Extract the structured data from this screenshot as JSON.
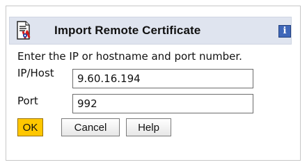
{
  "dialog": {
    "title": "Import Remote Certificate",
    "instruction": "Enter the IP or hostname and port number.",
    "icons": {
      "dialog": "certificate-icon",
      "info": "info-icon"
    }
  },
  "fields": {
    "ip_host": {
      "label": "IP/Host",
      "value": "9.60.16.194"
    },
    "port": {
      "label": "Port",
      "value": "992"
    }
  },
  "buttons": {
    "ok": "OK",
    "cancel": "Cancel",
    "help": "Help"
  },
  "colors": {
    "header_background": "#dfe4ef",
    "primary_button": "#ffc700",
    "info_icon": "#3f67b9"
  }
}
